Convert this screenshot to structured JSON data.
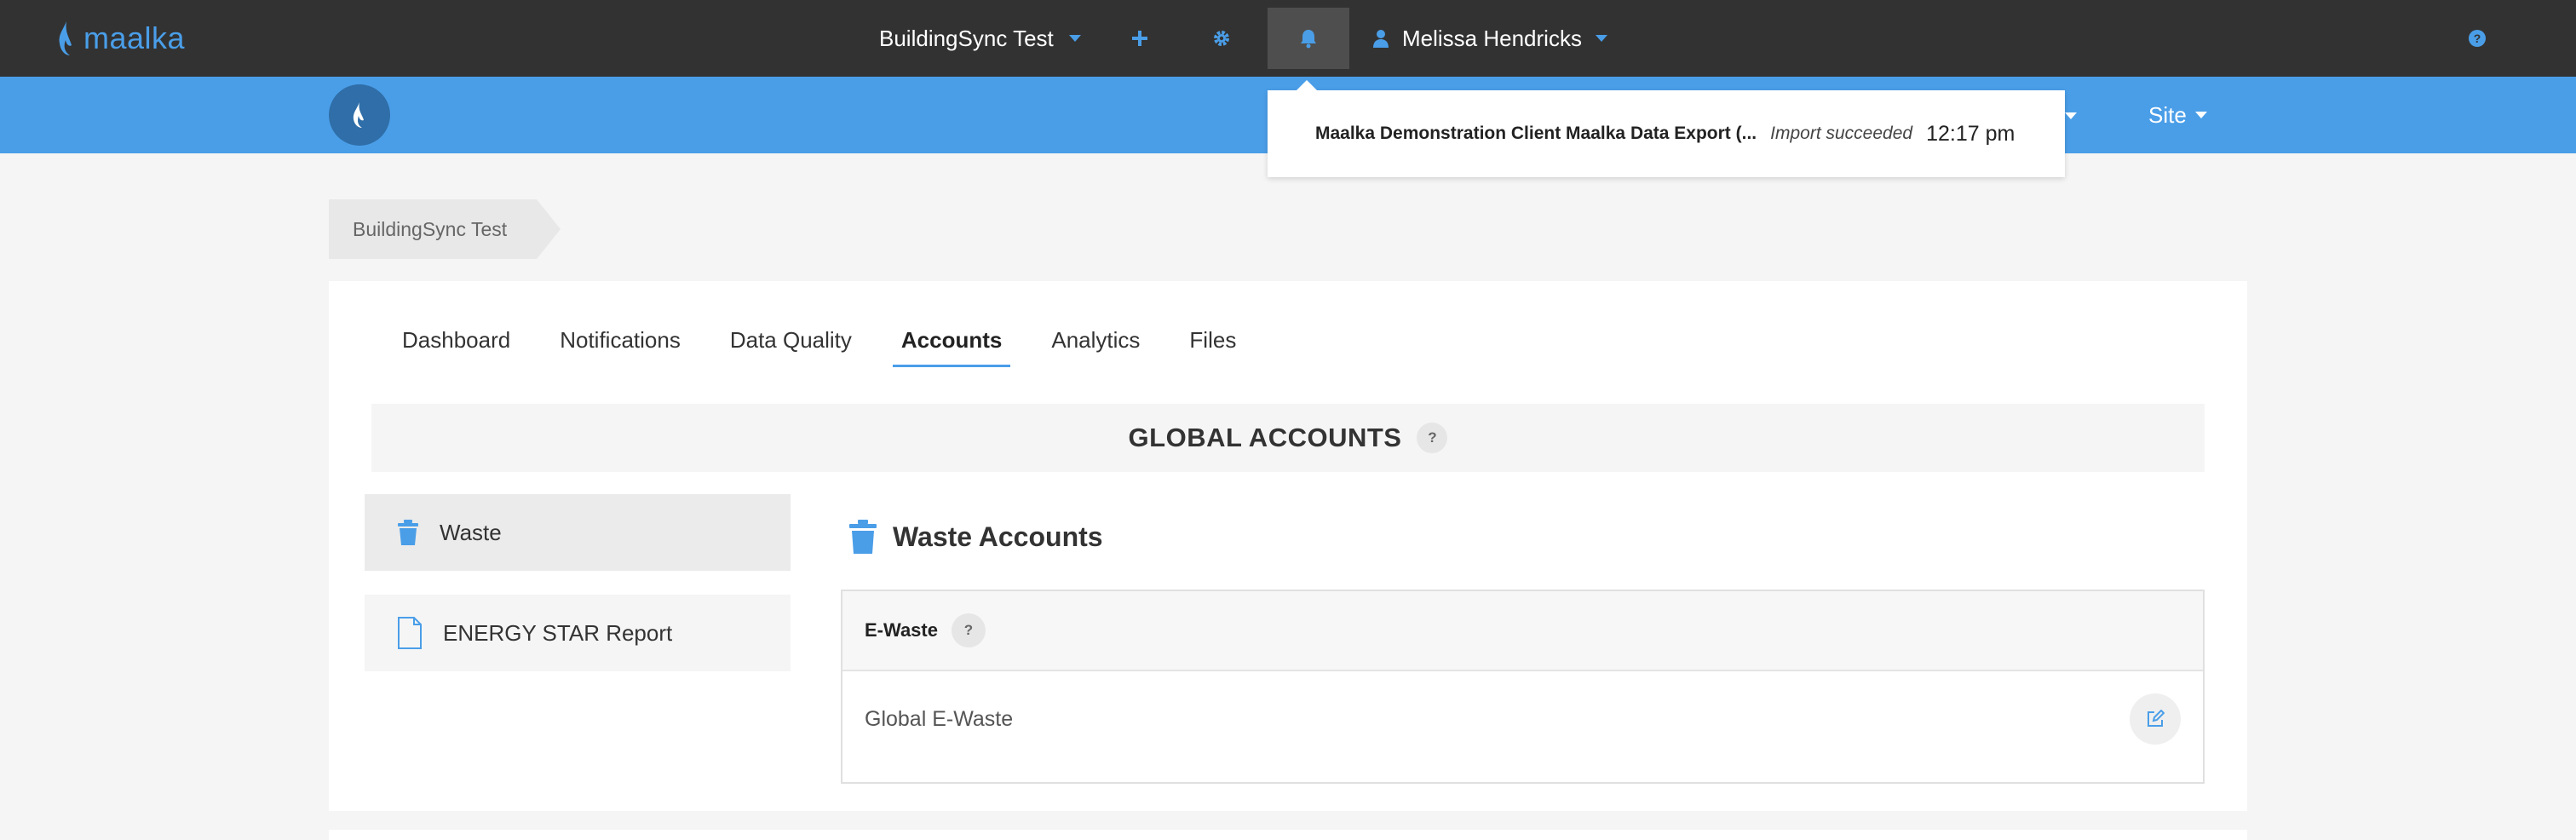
{
  "topbar": {
    "logo_text": "maalka",
    "project_name": "BuildingSync Test",
    "add_icon": "plus-icon",
    "settings_icon": "gear-icon",
    "notifications_icon": "bell-icon",
    "user_name": "Melissa Hendricks",
    "help_icon": "question-circle-icon"
  },
  "bluebar": {
    "site_menu_label": "Site"
  },
  "notification": {
    "title": "Maalka Demonstration Client Maalka Data Export (...",
    "status": "Import succeeded",
    "time": "12:17 pm"
  },
  "breadcrumb": {
    "label": "BuildingSync Test"
  },
  "tabs": [
    {
      "label": "Dashboard"
    },
    {
      "label": "Notifications"
    },
    {
      "label": "Data Quality"
    },
    {
      "label": "Accounts"
    },
    {
      "label": "Analytics"
    },
    {
      "label": "Files"
    }
  ],
  "active_tab": "Accounts",
  "global_accounts": {
    "title": "GLOBAL ACCOUNTS",
    "help": "?"
  },
  "sidebar": {
    "items": [
      {
        "label": "Waste",
        "icon": "trash-icon"
      },
      {
        "label": "ENERGY STAR Report",
        "icon": "file-icon"
      }
    ]
  },
  "section": {
    "title": "Waste Accounts",
    "icon": "trash-icon"
  },
  "accounts_table": {
    "header_label": "E-Waste",
    "header_help": "?",
    "rows": [
      {
        "label": "Global E-Waste",
        "action_icon": "edit-icon"
      }
    ]
  },
  "colors": {
    "topbar": "#323232",
    "accent": "#4a9ee8",
    "background": "#f5f5f5"
  }
}
